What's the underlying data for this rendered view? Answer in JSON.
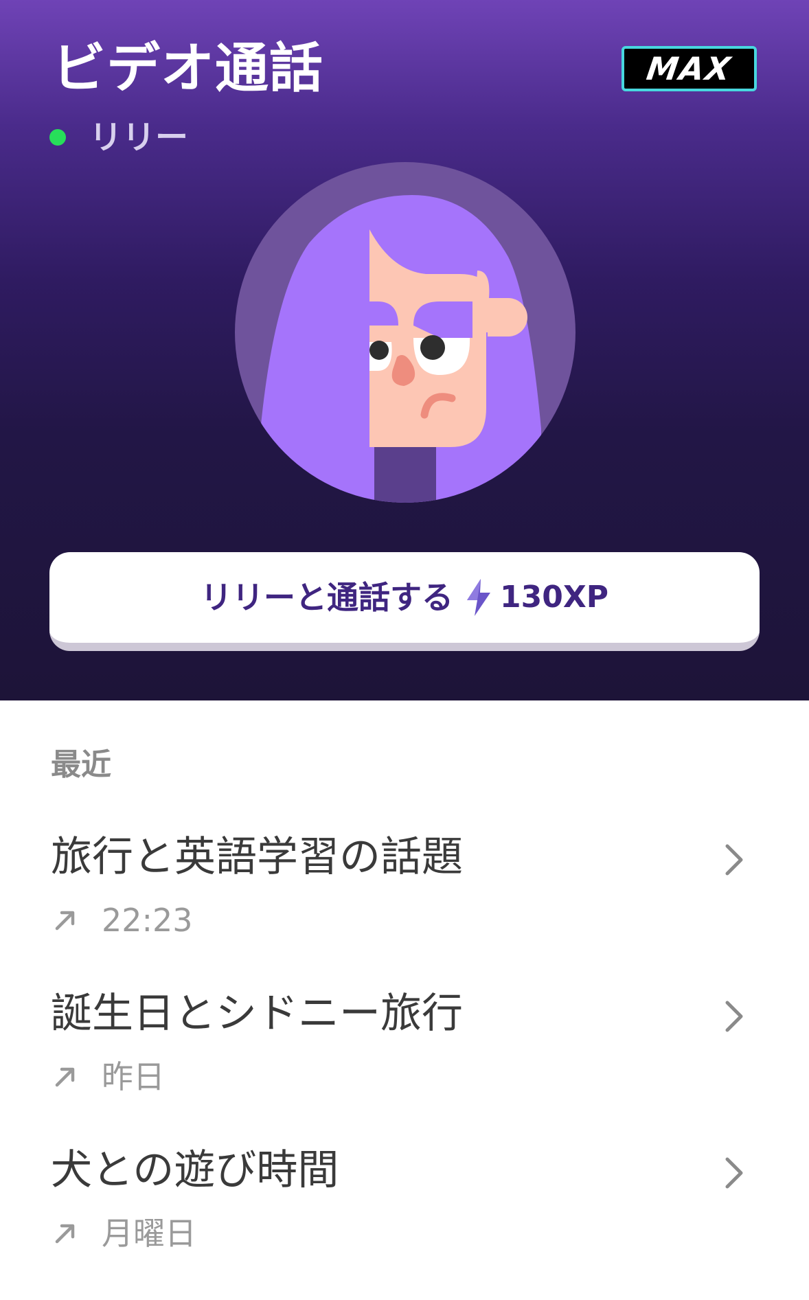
{
  "header": {
    "title": "ビデオ通話",
    "badge": "MAX"
  },
  "contact": {
    "name": "リリー",
    "status": "online",
    "status_color": "#27de5a"
  },
  "avatar": {
    "icon": "lily-avatar-icon"
  },
  "call_button": {
    "label": "リリーと通話する",
    "xp": "130XP",
    "icon": "lightning-bolt-icon"
  },
  "recent": {
    "label": "最近",
    "items": [
      {
        "title": "旅行と英語学習の話題",
        "time": "22:23",
        "icon": "outgoing-call-arrow-icon"
      },
      {
        "title": "誕生日とシドニー旅行",
        "time": "昨日",
        "icon": "outgoing-call-arrow-icon"
      },
      {
        "title": "犬との遊び時間",
        "time": "月曜日",
        "icon": "outgoing-call-arrow-icon"
      }
    ]
  },
  "colors": {
    "hero_top": "#6f43b6",
    "hero_bottom": "#1d1438",
    "badge_border": "#48d7df",
    "button_text": "#3f2580",
    "avatar_hair": "#a574fb",
    "avatar_skin": "#fdc6b4"
  }
}
